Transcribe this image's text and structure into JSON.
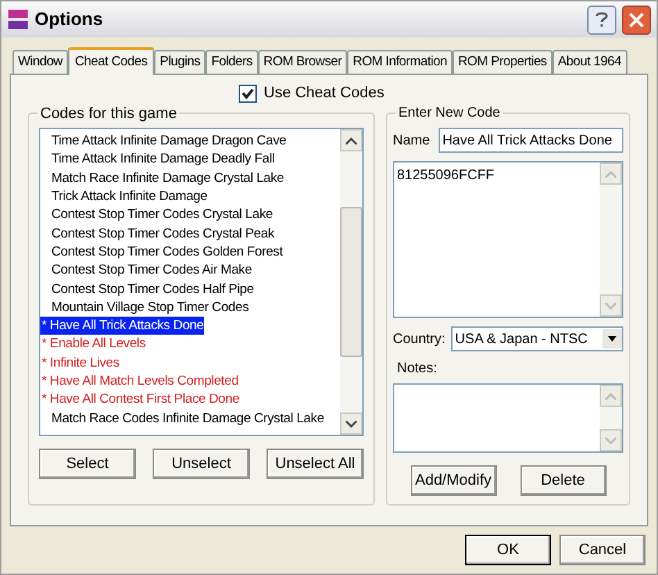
{
  "window": {
    "title": "Options"
  },
  "tabs": [
    {
      "label": "Window",
      "selected": false
    },
    {
      "label": "Cheat Codes",
      "selected": true
    },
    {
      "label": "Plugins",
      "selected": false
    },
    {
      "label": "Folders",
      "selected": false
    },
    {
      "label": "ROM Browser",
      "selected": false
    },
    {
      "label": "ROM Information",
      "selected": false
    },
    {
      "label": "ROM Properties",
      "selected": false
    },
    {
      "label": "About 1964",
      "selected": false
    }
  ],
  "use_cheat_codes": {
    "label": "Use Cheat Codes",
    "checked": true
  },
  "codes_group": {
    "title": "Codes for this game",
    "items": [
      {
        "label": "Time Attack Infinite Damage Dragon Cave",
        "active": false,
        "selected": false
      },
      {
        "label": "Time Attack Infinite Damage Deadly Fall",
        "active": false,
        "selected": false
      },
      {
        "label": "Match Race Infinite Damage Crystal Lake",
        "active": false,
        "selected": false
      },
      {
        "label": "Trick Attack Infinite Damage",
        "active": false,
        "selected": false
      },
      {
        "label": "Contest Stop Timer Codes Crystal Lake",
        "active": false,
        "selected": false
      },
      {
        "label": "Contest Stop Timer Codes Crystal Peak",
        "active": false,
        "selected": false
      },
      {
        "label": "Contest Stop Timer Codes Golden Forest",
        "active": false,
        "selected": false
      },
      {
        "label": "Contest Stop Timer Codes Air Make",
        "active": false,
        "selected": false
      },
      {
        "label": "Contest Stop Timer Codes Half Pipe",
        "active": false,
        "selected": false
      },
      {
        "label": "Mountain Village Stop Timer Codes",
        "active": false,
        "selected": false
      },
      {
        "label": "* Have All Trick Attacks Done",
        "active": true,
        "selected": true
      },
      {
        "label": "* Enable All Levels",
        "active": true,
        "selected": false
      },
      {
        "label": "* Infinite Lives",
        "active": true,
        "selected": false
      },
      {
        "label": "* Have All Match Levels Completed",
        "active": true,
        "selected": false
      },
      {
        "label": "* Have All Contest First Place Done",
        "active": true,
        "selected": false
      },
      {
        "label": "Match Race Codes Infinite Damage Crystal Lake",
        "active": false,
        "selected": false
      }
    ],
    "buttons": [
      "Select",
      "Unselect",
      "Unselect All"
    ]
  },
  "new_code_group": {
    "title": "Enter New Code",
    "name_label": "Name",
    "name_value": "Have All Trick Attacks Done",
    "code_value": "81255096FCFF",
    "country_label": "Country:",
    "country_value": "USA & Japan - NTSC",
    "notes_label": "Notes:",
    "buttons": [
      "Add/Modify",
      "Delete"
    ]
  },
  "dialog_buttons": [
    "OK",
    "Cancel"
  ]
}
